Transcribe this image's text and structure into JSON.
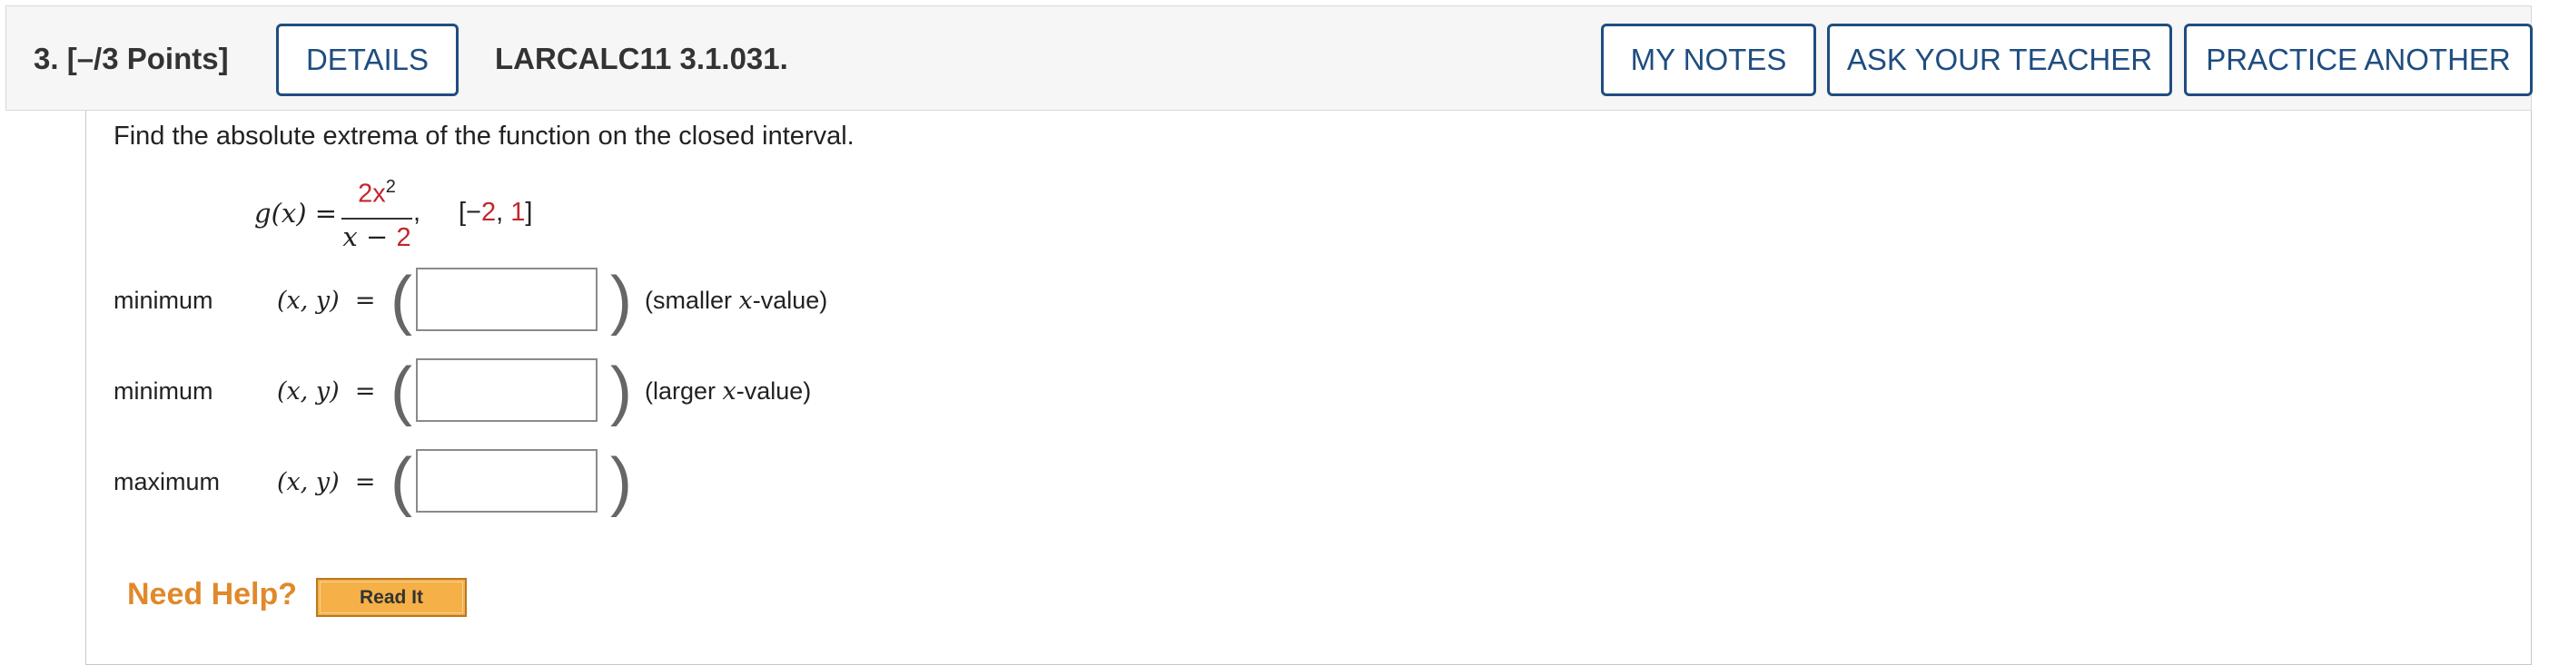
{
  "header": {
    "question_number": "3.",
    "points": "[–/3 Points]",
    "details_label": "DETAILS",
    "question_id": "LARCALC11 3.1.031.",
    "my_notes_label": "MY NOTES",
    "ask_teacher_label": "ASK YOUR TEACHER",
    "practice_label": "PRACTICE ANOTHER"
  },
  "problem": {
    "prompt": "Find the absolute extrema of the function on the closed interval.",
    "function_lhs": "g(x) =",
    "numerator": "2x",
    "numerator_exponent": "2",
    "denominator_var": "x − ",
    "denominator_const": "2",
    "interval_open": "[−",
    "interval_a": "2",
    "interval_sep": ", ",
    "interval_b": "1",
    "interval_close": "]"
  },
  "answers": [
    {
      "label": "minimum",
      "pair": "(x, y)",
      "equals": "=",
      "hint_prefix": "(smaller ",
      "hint_var": "x",
      "hint_suffix": "-value)",
      "value": ""
    },
    {
      "label": "minimum",
      "pair": "(x, y)",
      "equals": "=",
      "hint_prefix": "(larger ",
      "hint_var": "x",
      "hint_suffix": "-value)",
      "value": ""
    },
    {
      "label": "maximum",
      "pair": "(x, y)",
      "equals": "=",
      "value": ""
    }
  ],
  "help": {
    "need_help": "Need Help?",
    "read_it": "Read It"
  },
  "colors": {
    "brand_blue": "#1f4d80",
    "constant_red": "#c1272d",
    "help_orange": "#e0892b"
  }
}
